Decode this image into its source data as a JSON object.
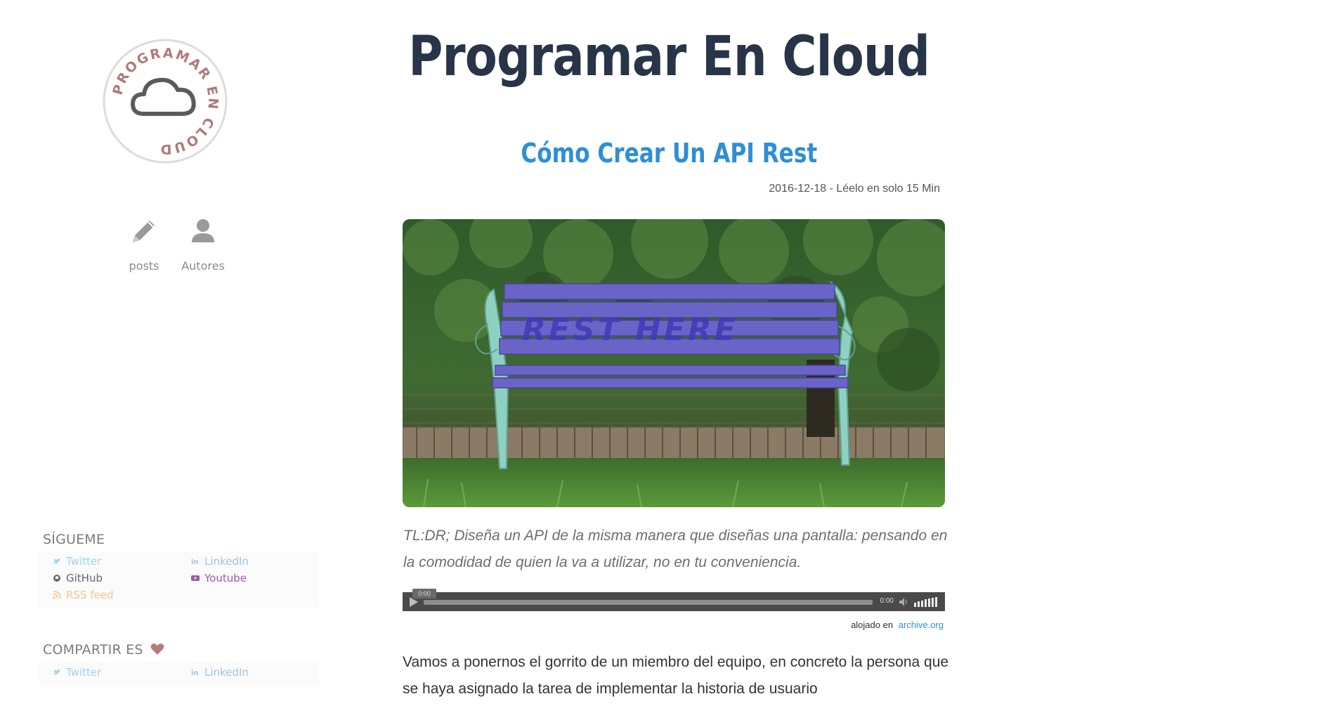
{
  "site": {
    "title": "Programar En Cloud",
    "logo_text": "PROGRAMAR EN CLOUD"
  },
  "nav": {
    "items": [
      {
        "label": "posts",
        "icon": "pencil-icon"
      },
      {
        "label": "Autores",
        "icon": "user-icon"
      }
    ]
  },
  "follow": {
    "title": "SÍGUEME",
    "links": [
      {
        "label": "Twitter",
        "icon": "twitter-icon",
        "color": "#9fd2ee"
      },
      {
        "label": "LinkedIn",
        "icon": "linkedin-icon",
        "color": "#9fc4e3"
      },
      {
        "label": "GitHub",
        "icon": "github-icon",
        "color": "#666666"
      },
      {
        "label": "Youtube",
        "icon": "youtube-icon",
        "color": "#a05aa8"
      },
      {
        "label": "RSS feed",
        "icon": "rss-icon",
        "color": "#f5c48a"
      }
    ]
  },
  "share": {
    "title": "COMPARTIR ES",
    "heart_color": "#b87b7b",
    "links": [
      {
        "label": "Twitter",
        "icon": "twitter-icon",
        "color": "#9fd2ee"
      },
      {
        "label": "LinkedIn",
        "icon": "linkedin-icon",
        "color": "#9fc4e3"
      }
    ]
  },
  "post": {
    "title": "Cómo Crear Un API Rest",
    "meta": "2016-12-18 - Léelo en solo 15 Min",
    "image_alt": "Banco azul con el texto REST HERE",
    "image_text": "REST HERE",
    "tldr": "TL:DR; Diseña un API de la misma manera que diseñas una pantalla: pensando en la comodidad de quien la va a utilizar, no en tu conveniencia.",
    "body": "Vamos a ponernos el gorrito de un miembro del equipo, en concreto la persona que se haya asignado la tarea de implementar la historia de usuario"
  },
  "player": {
    "current": "0:00",
    "duration": "0:00"
  },
  "hosted": {
    "label": "alojado en",
    "link": "archive.org"
  },
  "colors": {
    "title": "#283548",
    "accent": "#2f8ed6",
    "logo_ring": "#d8d8d8",
    "logo_text": "#b07a7a"
  }
}
